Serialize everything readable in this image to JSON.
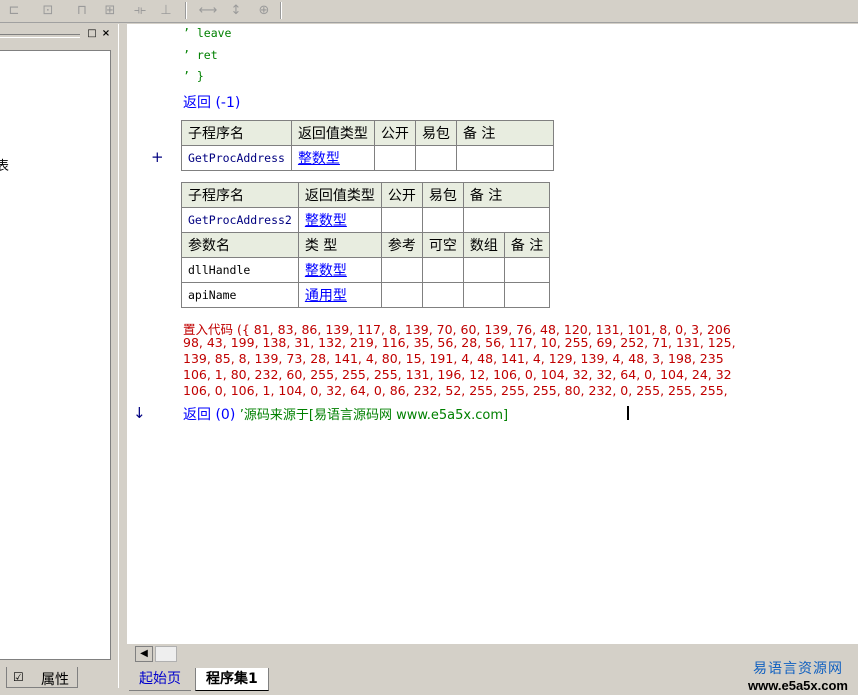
{
  "toolbar": {
    "icons": [
      "align-left-icon",
      "align-center-icon",
      "align-top-icon",
      "align-middle-icon",
      "equal-width-icon",
      "equal-height-icon",
      "h-expand-icon",
      "v-expand-icon",
      "center-icon"
    ]
  },
  "left_panel": {
    "stray_char": "表",
    "pin_label": "□",
    "close_label": "×"
  },
  "bottom_left_tab": {
    "label": "属性"
  },
  "code": {
    "comment_lines": [
      "’ leave",
      "’ ret",
      "’ }"
    ],
    "return_neg1": "返回 (-1)",
    "table1": {
      "headers": [
        "子程序名",
        "返回值类型",
        "公开",
        "易包",
        "备 注"
      ],
      "row": {
        "name": "GetProcAddress",
        "type": "整数型"
      }
    },
    "gutter_plus": "+",
    "table2": {
      "headers": [
        "子程序名",
        "返回值类型",
        "公开",
        "易包",
        "备 注"
      ],
      "row": {
        "name": "GetProcAddress2",
        "type": "整数型"
      },
      "param_headers": [
        "参数名",
        "类 型",
        "参考",
        "可空",
        "数组",
        "备 注"
      ],
      "params": [
        {
          "name": "dllHandle",
          "type": "整数型"
        },
        {
          "name": "apiName",
          "type": "通用型"
        }
      ]
    },
    "inject_lines": [
      "置入代码 ({ 81, 83, 86, 139, 117, 8, 139, 70, 60, 139, 76, 48, 120, 131, 101, 8, 0, 3, 206",
      "98, 43, 199, 138, 31, 132, 219, 116, 35, 56, 28, 56, 117, 10, 255, 69, 252, 71, 131, 125,",
      " 139, 85, 8, 139, 73, 28, 141, 4, 80, 15, 191, 4, 48, 141, 4, 129, 139, 4, 48, 3, 198, 235",
      " 106, 1, 80, 232, 60, 255, 255, 255, 131, 196, 12, 106, 0, 104, 32, 32, 64, 0, 104, 24, 32",
      " 106, 0, 106, 1, 104, 0, 32, 64, 0, 86, 232, 52, 255, 255, 255, 80, 232, 0, 255, 255, 255,"
    ],
    "gutter_arrow": "↓",
    "return_zero": "返回 (0)",
    "return_comment": "’源码来源于[易语言源码网 www.e5a5x.com]"
  },
  "tabs": [
    "起始页",
    "程序集1"
  ],
  "watermark": {
    "line1": "易语言资源网",
    "line2": "www.e5a5x.com"
  }
}
